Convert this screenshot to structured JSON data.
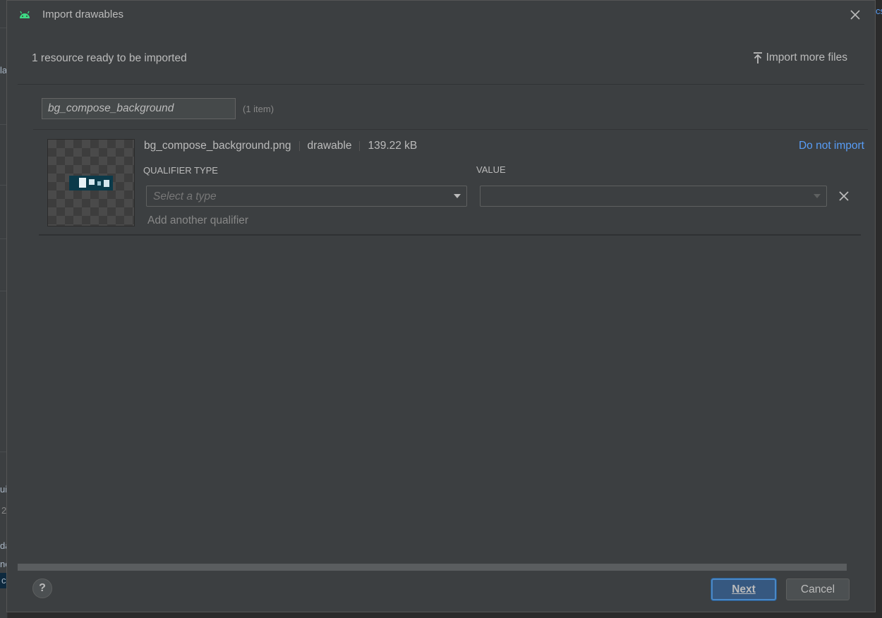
{
  "dialog": {
    "title": "Import drawables",
    "ready_text": "1 resource ready to be imported",
    "import_more_label": "Import more files"
  },
  "filter": {
    "value": "bg_compose_background",
    "count_label": "(1 item)"
  },
  "resource": {
    "file_name": "bg_compose_background.png",
    "resource_type": "drawable",
    "file_size": "139.22 kB",
    "do_not_import_label": "Do not import",
    "qualifier_type_header": "QUALIFIER TYPE",
    "value_header": "VALUE",
    "qualifier_type_placeholder": "Select a type",
    "value_selected": "",
    "add_qualifier_label": "Add another qualifier"
  },
  "footer": {
    "help_label": "?",
    "next_label": "Next",
    "cancel_label": "Cancel"
  },
  "background": {
    "fragments": [
      "la",
      "ui",
      "2",
      "da",
      "ne",
      "c",
      "cs"
    ]
  },
  "icons": {
    "app": "android-icon",
    "close": "close-icon",
    "upload": "upload-icon",
    "dropdown": "chevron-down-icon",
    "remove": "close-icon",
    "help": "help-icon"
  },
  "colors": {
    "dialog_bg": "#3c3f41",
    "link": "#589df6",
    "android_green": "#3ddc84",
    "primary_button": "#365880"
  }
}
